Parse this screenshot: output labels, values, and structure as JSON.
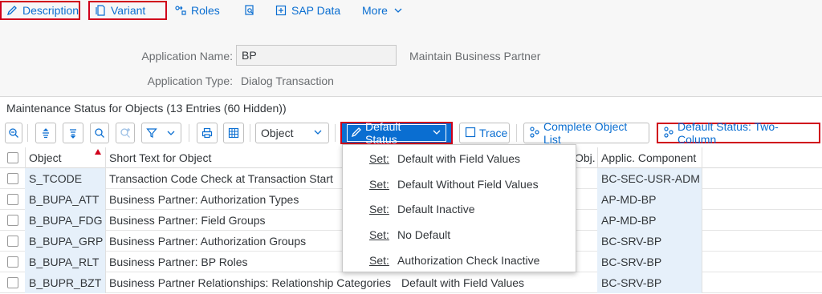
{
  "topmenu": {
    "description": "Description",
    "variant": "Variant",
    "roles": "Roles",
    "sap_data": "SAP Data",
    "more": "More"
  },
  "header": {
    "app_name_label": "Application Name:",
    "app_name_value": "BP",
    "app_name_desc": "Maintain Business Partner",
    "app_type_label": "Application Type:",
    "app_type_value": "Dialog Transaction"
  },
  "panel": {
    "title": "Maintenance Status for Objects (13 Entries (60 Hidden))"
  },
  "toolbar": {
    "object_select": "Object",
    "default_status": "Default Status",
    "trace": "Trace",
    "complete_object_list": "Complete Object List",
    "default_status_two_column": "Default Status: Two-Column"
  },
  "table": {
    "headers": {
      "object": "Object",
      "short_text": "Short Text for Object",
      "obj": "Obj.",
      "applic_component": "Applic. Component"
    },
    "rows": [
      {
        "object": "S_TCODE",
        "short_text": "Transaction Code Check at Transaction Start",
        "status": "",
        "component": "BC-SEC-USR-ADM"
      },
      {
        "object": "B_BUPA_ATT",
        "short_text": "Business Partner: Authorization Types",
        "status": "",
        "component": "AP-MD-BP"
      },
      {
        "object": "B_BUPA_FDG",
        "short_text": "Business Partner: Field Groups",
        "status": "",
        "component": "AP-MD-BP"
      },
      {
        "object": "B_BUPA_GRP",
        "short_text": "Business Partner: Authorization Groups",
        "status": "",
        "component": "BC-SRV-BP"
      },
      {
        "object": "B_BUPA_RLT",
        "short_text": "Business Partner: BP Roles",
        "status": "",
        "component": "BC-SRV-BP"
      },
      {
        "object": "B_BUPR_BZT",
        "short_text": "Business Partner Relationships: Relationship Categories",
        "status": "Default with Field Values",
        "component": "BC-SRV-BP"
      }
    ]
  },
  "dropdown": {
    "set_label": "Set:",
    "items": [
      "Default with Field Values",
      "Default Without Field Values",
      "Default Inactive",
      "No Default",
      "Authorization Check Inactive"
    ]
  },
  "colors": {
    "accent": "#0a6ed1",
    "highlight_border": "#d0011b",
    "object_cell_bg": "#e6f0fa"
  }
}
